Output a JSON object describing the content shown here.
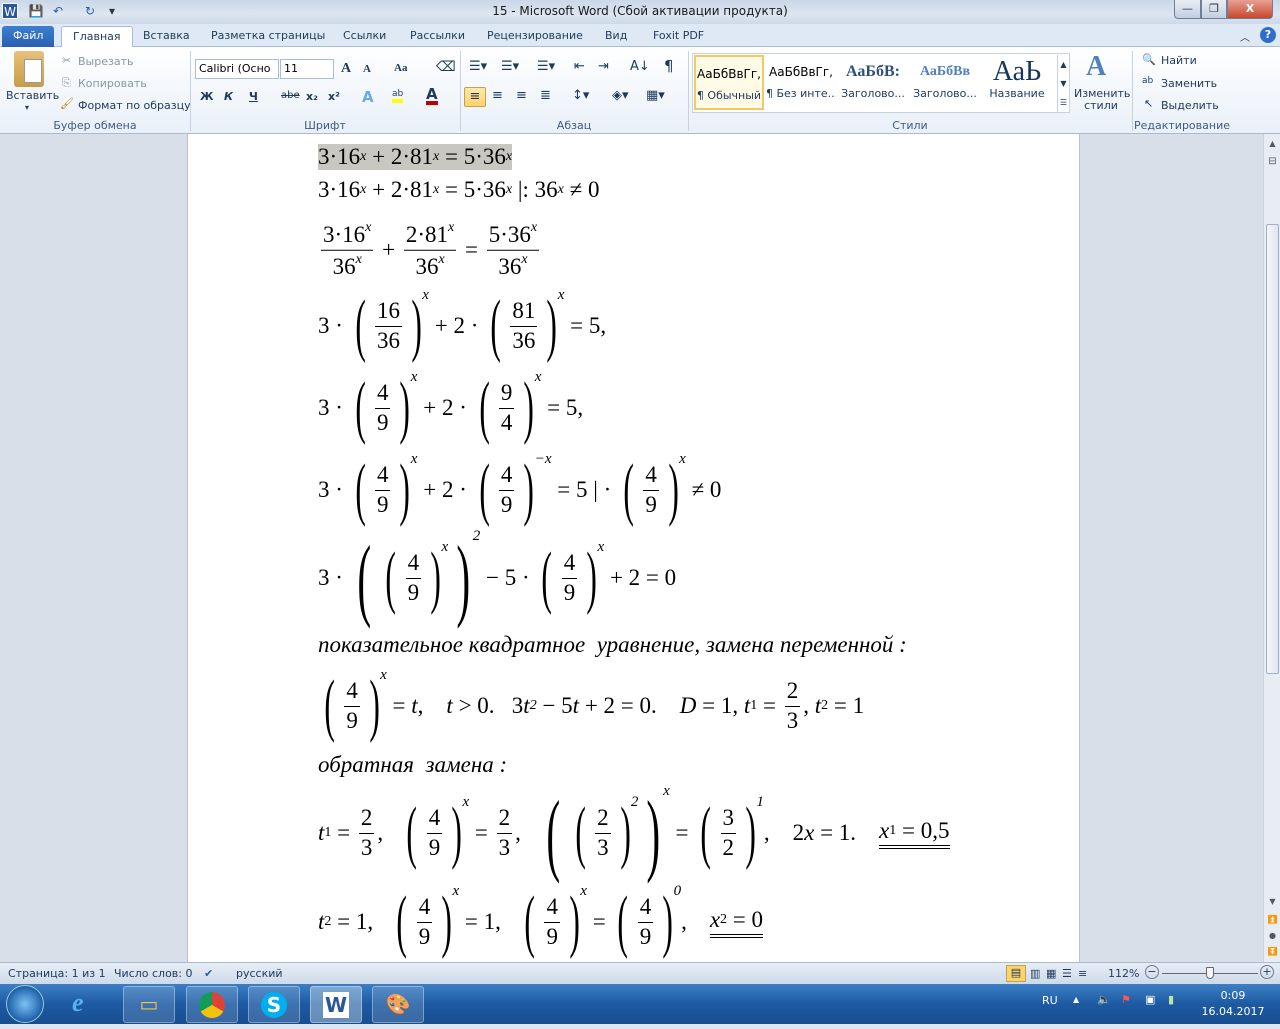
{
  "window": {
    "title": "15 - Microsoft Word (Сбой активации продукта)",
    "minimize": "—",
    "restore": "❐",
    "close": "X"
  },
  "quick_access": {
    "word_icon": "W",
    "save": "💾",
    "undo": "↶",
    "redo": "↻",
    "customize": "▾"
  },
  "tabs": [
    {
      "label": "Файл"
    },
    {
      "label": "Главная"
    },
    {
      "label": "Вставка"
    },
    {
      "label": "Разметка страницы"
    },
    {
      "label": "Ссылки"
    },
    {
      "label": "Рассылки"
    },
    {
      "label": "Рецензирование"
    },
    {
      "label": "Вид"
    },
    {
      "label": "Foxit PDF"
    }
  ],
  "ribbon": {
    "clipboard": {
      "paste": "Вставить",
      "cut": "Вырезать",
      "copy": "Копировать",
      "format_painter": "Формат по образцу",
      "label": "Буфер обмена"
    },
    "font": {
      "name": "Calibri (Осно",
      "size": "11",
      "grow": "A",
      "shrink": "A",
      "case": "Aa",
      "bold": "Ж",
      "italic": "К",
      "underline": "Ч",
      "strike": "abe",
      "subscript": "x₂",
      "superscript": "x²",
      "effects": "A",
      "highlight": "ab",
      "color": "A",
      "label": "Шрифт"
    },
    "paragraph": {
      "label": "Абзац",
      "pilcrow": "¶"
    },
    "styles": {
      "items": [
        {
          "sample": "АаБбВвГг,",
          "name": "¶ Обычный"
        },
        {
          "sample": "АаБбВвГг,",
          "name": "¶ Без инте..."
        },
        {
          "sample": "АаБбВ:",
          "name": "Заголово..."
        },
        {
          "sample": "АаБбВв",
          "name": "Заголово..."
        },
        {
          "sample": "АаЬ",
          "name": "Название"
        }
      ],
      "change": "Изменить стили",
      "label": "Стили"
    },
    "editing": {
      "find": "Найти",
      "replace": "Заменить",
      "select": "Выделить",
      "label": "Редактирование"
    }
  },
  "document": {
    "lines": [
      {
        "hl": true,
        "tokens": [
          "3·16",
          {
            "sup": "x"
          },
          " + 2·81",
          {
            "sup": "x"
          },
          " = 5·36",
          {
            "sup": "x"
          }
        ]
      },
      {
        "tokens": [
          "3·16",
          {
            "sup": "x"
          },
          " + 2·81",
          {
            "sup": "x"
          },
          " = 5·36",
          {
            "sup": "x"
          },
          " |: 36",
          {
            "sup": "x"
          },
          " ≠ 0"
        ]
      },
      {
        "tokens": [
          {
            "frac": [
              [
                "3·16",
                {
                  "sup": "x"
                }
              ],
              [
                "36",
                {
                  "sup": "x"
                }
              ]
            ]
          },
          " + ",
          {
            "frac": [
              [
                "2·81",
                {
                  "sup": "x"
                }
              ],
              [
                "36",
                {
                  "sup": "x"
                }
              ]
            ]
          },
          " = ",
          {
            "frac": [
              [
                "5·36",
                {
                  "sup": "x"
                }
              ],
              [
                "36",
                {
                  "sup": "x"
                }
              ]
            ]
          }
        ]
      },
      {
        "tokens": [
          "3 · ",
          {
            "p": [
              {
                "frac": [
                  [
                    "16"
                  ],
                  [
                    "36"
                  ]
                ]
              }
            ],
            "exp": "x"
          },
          " + 2 · ",
          {
            "p": [
              {
                "frac": [
                  [
                    "81"
                  ],
                  [
                    "36"
                  ]
                ]
              }
            ],
            "exp": "x"
          },
          " = 5,"
        ]
      },
      {
        "tokens": [
          "3 · ",
          {
            "p": [
              {
                "frac": [
                  [
                    "4"
                  ],
                  [
                    "9"
                  ]
                ]
              }
            ],
            "exp": "x"
          },
          " + 2 · ",
          {
            "p": [
              {
                "frac": [
                  [
                    "9"
                  ],
                  [
                    "4"
                  ]
                ]
              }
            ],
            "exp": "x"
          },
          " = 5,"
        ]
      },
      {
        "tokens": [
          "3 · ",
          {
            "p": [
              {
                "frac": [
                  [
                    "4"
                  ],
                  [
                    "9"
                  ]
                ]
              }
            ],
            "exp": "x"
          },
          " + 2 · ",
          {
            "p": [
              {
                "frac": [
                  [
                    "4"
                  ],
                  [
                    "9"
                  ]
                ]
              }
            ],
            "exp": "−x"
          },
          " = 5 | · ",
          {
            "p": [
              {
                "frac": [
                  [
                    "4"
                  ],
                  [
                    "9"
                  ]
                ]
              }
            ],
            "exp": "x"
          },
          " ≠ 0"
        ]
      },
      {
        "tokens": [
          "3 · ",
          {
            "p": [
              {
                "p": [
                  {
                    "frac": [
                      [
                        "4"
                      ],
                      [
                        "9"
                      ]
                    ]
                  }
                ],
                "exp": "x"
              }
            ],
            "exp": "2",
            "outer": true
          },
          " − 5 · ",
          {
            "p": [
              {
                "frac": [
                  [
                    "4"
                  ],
                  [
                    "9"
                  ]
                ]
              }
            ],
            "exp": "x"
          },
          " + 2 = 0"
        ]
      },
      {
        "tokens": [
          {
            "i": "показательное квадратное  уравнение, замена переменной :"
          }
        ]
      },
      {
        "tokens": [
          {
            "p": [
              {
                "frac": [
                  [
                    "4"
                  ],
                  [
                    "9"
                  ]
                ]
              }
            ],
            "exp": "x"
          },
          " = ",
          {
            "i": "t"
          },
          ",    ",
          {
            "i": "t"
          },
          " > 0.   3",
          {
            "i": "t"
          },
          {
            "sup": "2"
          },
          " − 5",
          {
            "i": "t"
          },
          " + 2 = 0.    ",
          {
            "i": "D"
          },
          " = 1, ",
          {
            "i": "t"
          },
          {
            "sub": "1"
          },
          " = ",
          {
            "frac": [
              [
                "2"
              ],
              [
                "3"
              ]
            ]
          },
          ", ",
          {
            "i": "t"
          },
          {
            "sub": "2"
          },
          " = 1"
        ]
      },
      {
        "tokens": [
          {
            "i": "обратная  замена :"
          }
        ]
      },
      {
        "tokens": [
          {
            "i": "t"
          },
          {
            "sub": "1"
          },
          " = ",
          {
            "frac": [
              [
                "2"
              ],
              [
                "3"
              ]
            ]
          },
          ",   ",
          {
            "p": [
              {
                "frac": [
                  [
                    "4"
                  ],
                  [
                    "9"
                  ]
                ]
              }
            ],
            "exp": "x"
          },
          " = ",
          {
            "frac": [
              [
                "2"
              ],
              [
                "3"
              ]
            ]
          },
          ",   ",
          {
            "p": [
              {
                "p": [
                  {
                    "frac": [
                      [
                        "2"
                      ],
                      [
                        "3"
                      ]
                    ]
                  }
                ],
                "exp": "2"
              }
            ],
            "exp": "x",
            "outer": true
          },
          " = ",
          {
            "p": [
              {
                "frac": [
                  [
                    "3"
                  ],
                  [
                    "2"
                  ]
                ]
              }
            ],
            "exp": "1"
          },
          ",    2",
          {
            "i": "x"
          },
          " = 1.    ",
          {
            "ul": [
              {
                "i": "x"
              },
              {
                "sub": "1"
              },
              " = 0,5"
            ]
          }
        ]
      },
      {
        "tokens": [
          {
            "i": "t"
          },
          {
            "sub": "2"
          },
          " = 1,   ",
          {
            "p": [
              {
                "frac": [
                  [
                    "4"
                  ],
                  [
                    "9"
                  ]
                ]
              }
            ],
            "exp": "x"
          },
          " = 1,   ",
          {
            "p": [
              {
                "frac": [
                  [
                    "4"
                  ],
                  [
                    "9"
                  ]
                ]
              }
            ],
            "exp": "x"
          },
          " = ",
          {
            "p": [
              {
                "frac": [
                  [
                    "4"
                  ],
                  [
                    "9"
                  ]
                ]
              }
            ],
            "exp": "0"
          },
          ",    ",
          {
            "ul": [
              {
                "i": "x"
              },
              {
                "sub": "2"
              },
              " = 0"
            ]
          }
        ]
      }
    ]
  },
  "statusbar": {
    "page": "Страница: 1 из 1",
    "words": "Число слов: 0",
    "language": "русский",
    "zoom": "112%",
    "zoom_minus": "−",
    "zoom_plus": "+"
  },
  "taskbar": {
    "lang": "RU",
    "time": "0:09",
    "date": "16.04.2017"
  }
}
